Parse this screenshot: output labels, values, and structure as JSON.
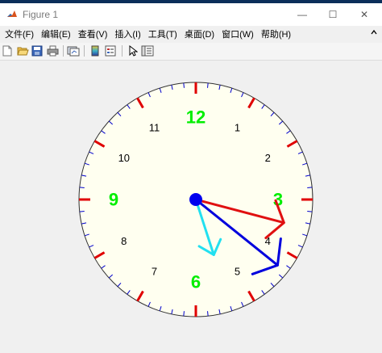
{
  "window": {
    "title": "Figure 1",
    "minimize_glyph": "—",
    "maximize_glyph": "☐",
    "close_glyph": "✕"
  },
  "menu": [
    {
      "label": "文件(F)"
    },
    {
      "label": "编辑(E)"
    },
    {
      "label": "查看(V)"
    },
    {
      "label": "插入(I)"
    },
    {
      "label": "工具(T)"
    },
    {
      "label": "桌面(D)"
    },
    {
      "label": "窗口(W)"
    },
    {
      "label": "帮助(H)"
    }
  ],
  "toolbar_icons": [
    "new-figure-icon",
    "open-file-icon",
    "save-icon",
    "print-icon",
    "link-plot-icon",
    "colorbar-icon",
    "legend-icon",
    "pointer-icon",
    "property-inspector-icon"
  ],
  "clock": {
    "major_labels": [
      {
        "text": "12",
        "hour": 12
      },
      {
        "text": "3",
        "hour": 3
      },
      {
        "text": "6",
        "hour": 6
      },
      {
        "text": "9",
        "hour": 9
      }
    ],
    "minor_labels": [
      {
        "text": "1",
        "hour": 1
      },
      {
        "text": "2",
        "hour": 2
      },
      {
        "text": "4",
        "hour": 4
      },
      {
        "text": "5",
        "hour": 5
      },
      {
        "text": "7",
        "hour": 7
      },
      {
        "text": "8",
        "hour": 8
      },
      {
        "text": "10",
        "hour": 10
      },
      {
        "text": "11",
        "hour": 11
      }
    ],
    "time": {
      "hour": 4,
      "minute": 17,
      "second": 27
    },
    "colors": {
      "face": "#fffff0",
      "rim": "#303030",
      "hour_tick": "#e00000",
      "minute_tick": "#0000cc",
      "major_label": "#00ee00",
      "minor_label": "#000000",
      "hour_hand": "#0000dd",
      "minute_hand": "#e01010",
      "second_hand": "#22e0f0",
      "hub": "#0000ee"
    }
  }
}
